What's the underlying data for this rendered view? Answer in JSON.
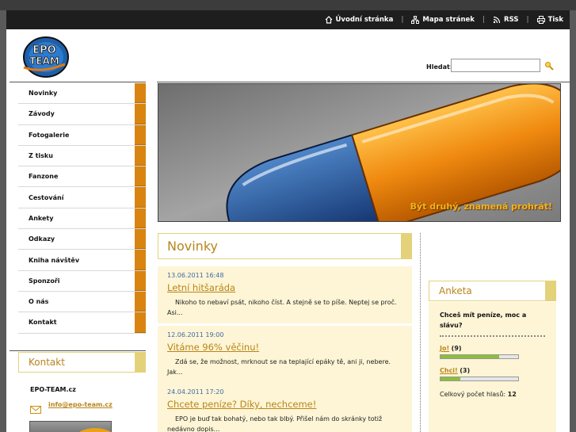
{
  "toplinks": {
    "home": "Úvodní stránka",
    "sitemap": "Mapa stránek",
    "rss": "RSS",
    "print": "Tisk"
  },
  "search": {
    "label": "Hledat:",
    "value": ""
  },
  "logo": {
    "text_top": "EPO",
    "text_bottom": "TEAM"
  },
  "nav": [
    "Novinky",
    "Závody",
    "Fotogalerie",
    "Z tisku",
    "Fanzone",
    "Cestování",
    "Ankety",
    "Odkazy",
    "Kniha návštěv",
    "Sponzoři",
    "O nás",
    "Kontakt"
  ],
  "contact": {
    "heading": "Kontakt",
    "name": "EPO-TEAM.cz",
    "email": "info@epo-team.cz"
  },
  "banner": {
    "caption": "Být druhý, znamená prohrát!"
  },
  "news": {
    "heading": "Novinky",
    "posts": [
      {
        "date": "13.06.2011 16:48",
        "title": "Letní hitšaráda",
        "text": "Nikoho to nebaví psát, nikoho číst. A stejně se to píše. Neptej se proč. Asi..."
      },
      {
        "date": "12.06.2011 19:00",
        "title": "Vitáme 96% věčinu!",
        "text": "Zdá se, že možnost, mrknout se na teplající epáky tě, ani ji, nebere. Jak..."
      },
      {
        "date": "24.04.2011 17:20",
        "title": "Chcete peníze? Díky, nechceme!",
        "text": "EPO je buď tak bohatý, nebo tak blbý. Přišel nám do skránky totiž nedávno dopis..."
      }
    ]
  },
  "poll": {
    "heading": "Anketa",
    "question": "Chceš mít peníze, moc a slávu?",
    "answers": [
      {
        "label": "Jo!",
        "count": "(9)",
        "fraction": 0.75
      },
      {
        "label": "Chci!",
        "count": "(3)",
        "fraction": 0.25
      }
    ],
    "total_label": "Celkový počet hlasů:",
    "total": "12"
  },
  "colors": {
    "accent": "#d98410",
    "gold": "#b8851a",
    "panel": "#fdf5d5"
  }
}
